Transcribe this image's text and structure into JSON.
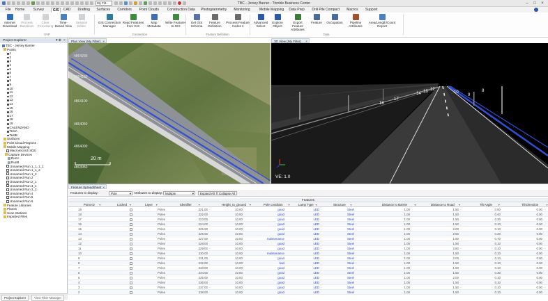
{
  "window": {
    "title": "TBC - Jersey Barrier - Trimble Business Center",
    "combo_value": "My Filt..."
  },
  "menu_tabs": [
    "File",
    "Home",
    "Survey",
    "GIS",
    "CAD",
    "Drafting",
    "Surfaces",
    "Corridors",
    "Point Clouds",
    "Construction Data",
    "Photogrammetry",
    "Monitoring",
    "Mobile Mapping",
    "Data Prep",
    "Drill Pile Compact",
    "Macros",
    "Support"
  ],
  "active_tab": "GIS",
  "ribbon": {
    "buttons": [
      {
        "l1": "Internet",
        "l2": "Download",
        "color": "#2c6fbf",
        "disabled": false
      },
      {
        "l1": "Process",
        "l2": "Baselines",
        "color": "#9aa0a6",
        "disabled": true
      },
      {
        "l1": "Clear",
        "l2": "Processing",
        "color": "#9aa0a6",
        "disabled": true
      },
      {
        "l1": "Time-",
        "l2": "Based View",
        "color": "#4a7fc0",
        "disabled": false
      },
      {
        "l1": "Session",
        "l2": "Editor",
        "color": "#9aa0a6",
        "disabled": true
      },
      {
        "l1": "GIS Connection",
        "l2": "Manager",
        "color": "#2d7a9a",
        "disabled": false
      },
      {
        "l1": "Read Features",
        "l2": "from GIS",
        "color": "#3c8b3c",
        "disabled": false
      },
      {
        "l1": "Map",
        "l2": "Metadata",
        "color": "#3b70b8",
        "disabled": false
      },
      {
        "l1": "Write Features",
        "l2": "to GIS",
        "color": "#3c8b3c",
        "disabled": false
      },
      {
        "l1": "Get GIS",
        "l2": "Schema",
        "color": "#5b6fa8",
        "disabled": false
      },
      {
        "l1": "Feature",
        "l2": "Definition",
        "color": "#6a6a6a",
        "disabled": false
      },
      {
        "l1": "Process Feature",
        "l2": "Codes ▾",
        "color": "#6a6a6a",
        "disabled": false
      },
      {
        "l1": "Advanced",
        "l2": "Select",
        "color": "#2b58a7",
        "disabled": false
      },
      {
        "l1": "Explore",
        "l2": "Object",
        "color": "#2b58a7",
        "disabled": false
      },
      {
        "l1": "Export Feature",
        "l2": "Attributes",
        "color": "#3b7a3b",
        "disabled": false
      },
      {
        "l1": "Feature",
        "l2": "",
        "color": "#4a6a9a",
        "disabled": false
      },
      {
        "l1": "Occupation",
        "l2": "",
        "color": "#4a6a9a",
        "disabled": false
      },
      {
        "l1": "Pipeline",
        "l2": "Attributes",
        "color": "#a0522d",
        "disabled": false
      },
      {
        "l1": "Area/Length/Count",
        "l2": "Report",
        "color": "#4a7fc0",
        "disabled": false
      }
    ],
    "groups": [
      "SVP",
      "Connection",
      "Feature Definition",
      "Data"
    ]
  },
  "project_explorer": {
    "title": "Project Explorer",
    "tree": [
      {
        "label": "TBC - Jersey Barrier",
        "kind": "root"
      },
      {
        "label": "Points",
        "kind": "folder"
      },
      {
        "label": "1",
        "kind": "pt"
      },
      {
        "label": "2",
        "kind": "pt"
      },
      {
        "label": "3",
        "kind": "pt"
      },
      {
        "label": "4",
        "kind": "pt"
      },
      {
        "label": "5",
        "kind": "pt"
      },
      {
        "label": "6",
        "kind": "pt"
      },
      {
        "label": "7",
        "kind": "pt"
      },
      {
        "label": "8",
        "kind": "pt"
      },
      {
        "label": "9",
        "kind": "pt"
      },
      {
        "label": "10",
        "kind": "pt"
      },
      {
        "label": "11",
        "kind": "pt"
      },
      {
        "label": "12",
        "kind": "pt"
      },
      {
        "label": "13",
        "kind": "pt"
      },
      {
        "label": "14",
        "kind": "pt"
      },
      {
        "label": "15",
        "kind": "pt"
      },
      {
        "label": "16",
        "kind": "pt"
      },
      {
        "label": "17",
        "kind": "pt"
      },
      {
        "label": "18",
        "kind": "pt"
      },
      {
        "label": "19",
        "kind": "pt"
      },
      {
        "label": "CALENZANO",
        "kind": "pt"
      },
      {
        "label": "TestA",
        "kind": "pt"
      },
      {
        "label": "TestB",
        "kind": "pt"
      },
      {
        "label": "Surfaces",
        "kind": "folder"
      },
      {
        "label": "Point Cloud Regions",
        "kind": "folder"
      },
      {
        "label": "Mobile Mapping",
        "kind": "folder"
      },
      {
        "label": "Macrorecord (402)",
        "kind": "chk"
      },
      {
        "label": "Capture Devices",
        "kind": "folder"
      },
      {
        "label": "RunA",
        "kind": "lt"
      },
      {
        "label": "RunB",
        "kind": "lt"
      },
      {
        "label": "Unnamed Run 1_1_1_1",
        "kind": "chk"
      },
      {
        "label": "Unnamed Run 1_1_2",
        "kind": "chk"
      },
      {
        "label": "Unnamed Run 1_2",
        "kind": "chk"
      },
      {
        "label": "Unnamed Run 2",
        "kind": "chk"
      },
      {
        "label": "Unnamed Run 2_1",
        "kind": "chk"
      },
      {
        "label": "Unnamed Run 3_1",
        "kind": "chk"
      },
      {
        "label": "Unnamed Run 3_2",
        "kind": "chk"
      },
      {
        "label": "Unnamed Run 4",
        "kind": "chk"
      },
      {
        "label": "Unnamed Run 5",
        "kind": "chk"
      },
      {
        "label": "Unnamed Run 6",
        "kind": "chk"
      },
      {
        "label": "Feature Libraries",
        "kind": "folder"
      },
      {
        "label": "Planes",
        "kind": "folder"
      },
      {
        "label": "Scan Stations",
        "kind": "folder"
      },
      {
        "label": "Imported Files",
        "kind": "folder"
      }
    ],
    "bottom_tabs": [
      "Project Explorer",
      "View Filter Manager"
    ]
  },
  "plan_view": {
    "tab": "Plan View (My Filter)",
    "labels": [
      "4864200",
      "4864150",
      "4864100",
      "4864050",
      "4864000",
      "4863950"
    ],
    "scale": "20 m"
  },
  "view_3d": {
    "tab": "3D View (My Filter)",
    "ve": "VE: 1.0",
    "labels": [
      "18",
      "17",
      "14",
      "13",
      "12",
      "10",
      "9",
      "8"
    ]
  },
  "spreadsheet": {
    "tab": "Feature Spreadsheet",
    "features_label": "Features to display:",
    "features_value": "Pole",
    "attrs_label": "Attributes to display:",
    "attrs_value": "Multiple",
    "expand": "Expand All",
    "collapse": "Collapse All",
    "group_header": "Features",
    "columns": [
      "Point ID",
      "Locked",
      "Layer",
      "Identifier",
      "Height_to_ground",
      "Pole condition",
      "Lamp Type",
      "Structure",
      "Distance to Barrier",
      "Distance to Road",
      "Tilt Angle",
      "Tilt Direction"
    ],
    "rows": [
      [
        "19",
        "",
        "Poles",
        "221.00",
        "10.00",
        "good",
        "LED",
        "Steel",
        "1.00",
        "1.50",
        "0.00",
        "0.00"
      ],
      [
        "18",
        "",
        "Poles",
        "222.00",
        "10.00",
        "good",
        "LED",
        "Steel",
        "1.00",
        "1.50",
        "0.40",
        "0.00"
      ],
      [
        "17",
        "",
        "Poles",
        "223.00",
        "10.00",
        "good",
        "LED",
        "Steel",
        "1.00",
        "1.50",
        "0.30",
        "0.00"
      ],
      [
        "16",
        "",
        "Poles",
        "224.00",
        "10.00",
        "good",
        "LED",
        "Steel",
        "1.00",
        "1.50",
        "0.10",
        "0.00"
      ],
      [
        "15",
        "",
        "Poles",
        "225.00",
        "10.00",
        "good",
        "LED",
        "Steel",
        "1.00",
        "2.00",
        "0.10",
        "0.00"
      ],
      [
        "14",
        "",
        "Poles",
        "226.00",
        "10.00",
        "good",
        "LED",
        "Steel",
        "1.00",
        "2.50",
        "0.20",
        "0.00"
      ],
      [
        "13",
        "",
        "Poles",
        "227.00",
        "10.00",
        "maintenance",
        "LED",
        "Steel",
        "1.00",
        "1.50",
        "0.70",
        "0.00"
      ],
      [
        "12",
        "",
        "Poles",
        "228.00",
        "10.00",
        "good",
        "LED",
        "Steel",
        "1.00",
        "1.50",
        "0.10",
        "0.00"
      ],
      [
        "11",
        "",
        "Poles",
        "229.00",
        "10.00",
        "good",
        "LED",
        "Steel",
        "1.00",
        "2.80",
        "0.10",
        "0.00"
      ],
      [
        "10",
        "",
        "Poles",
        "230.00",
        "10.00",
        "maintenance",
        "LED",
        "Steel",
        "1.00",
        "1.50",
        "0.10",
        "0.00"
      ],
      [
        "9",
        "",
        "Poles",
        "231.00",
        "10.00",
        "good",
        "LED",
        "Steel",
        "1.00",
        "2.00",
        "0.10",
        "0.00"
      ],
      [
        "8",
        "",
        "Poles",
        "232.00",
        "10.00",
        "bad",
        "LED",
        "Steel",
        "1.00",
        "1.50",
        "0.10",
        "0.00"
      ],
      [
        "7",
        "",
        "Poles",
        "233.00",
        "10.00",
        "good",
        "LED",
        "Steel",
        "1.00",
        "1.50",
        "0.10",
        "0.00"
      ],
      [
        "6",
        "",
        "Poles",
        "234.00",
        "10.00",
        "good",
        "LED",
        "Steel",
        "1.00",
        "1.50",
        "0.30",
        "0.00"
      ],
      [
        "5",
        "",
        "Poles",
        "235.00",
        "10.00",
        "good",
        "LED",
        "Steel",
        "1.00",
        "2.00",
        "0.10",
        "0.00"
      ],
      [
        "4",
        "",
        "Poles",
        "236.00",
        "10.00",
        "good",
        "LED",
        "Steel",
        "1.00",
        "1.50",
        "0.10",
        "0.00"
      ],
      [
        "3",
        "",
        "Poles",
        "237.00",
        "10.00",
        "good",
        "LED",
        "Steel",
        "1.00",
        "1.50",
        "0.10",
        "0.00"
      ],
      [
        "2",
        "",
        "Poles",
        "238.00",
        "10.00",
        "good",
        "LED",
        "Steel",
        "1.00",
        "1.50",
        "0.10",
        "0.00"
      ]
    ]
  }
}
